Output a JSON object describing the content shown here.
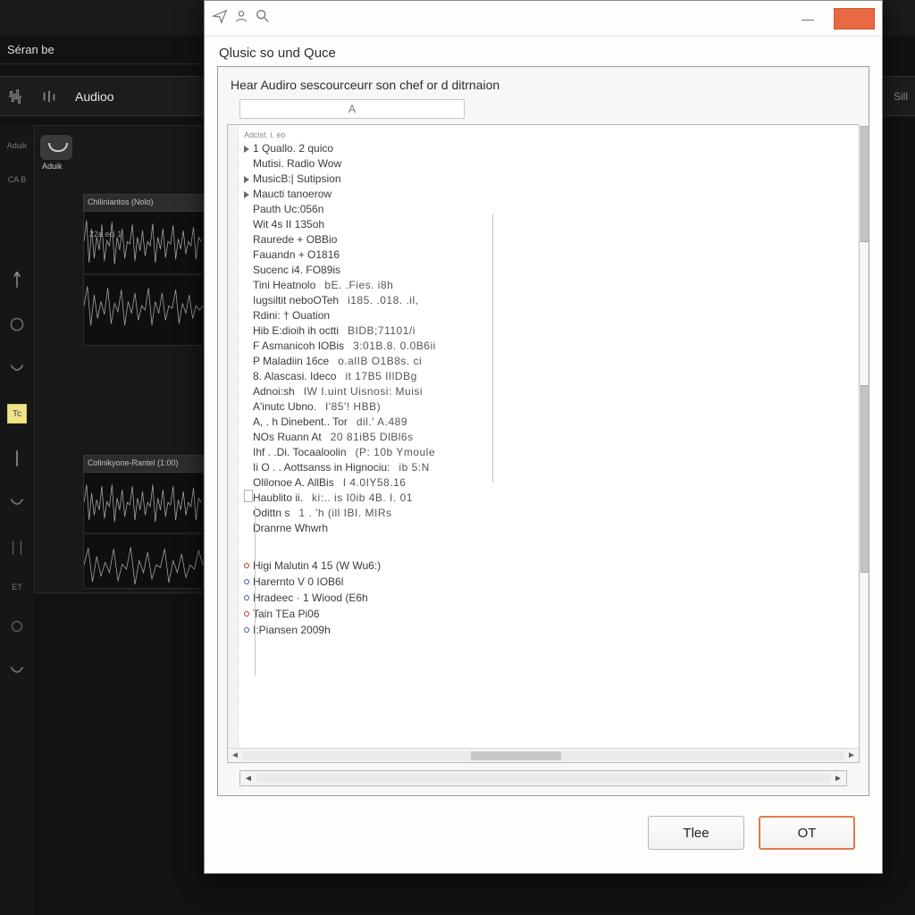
{
  "bg": {
    "subbar_label": "Séran be",
    "toolbar_audio": "Audioo",
    "toolbar_short": "Sill",
    "left_rail_label_top": "Aduik",
    "left_rail_label_ca": "CA B",
    "left_rail_label_et": "ET",
    "tc_label": "Tc",
    "track_mini_label": "Aduik",
    "track1_header": "Chiliniantos (Nolo)",
    "track1_time": "22a eci 1",
    "track2_header": "Colinikyone-Rantel (1:00)"
  },
  "dialog": {
    "title": "Qlusic so und Quce",
    "subheading": "Hear Audiro sescourceurr son chef or d ditrnaion",
    "filter_placeholder": "A",
    "tiny_header": "Adcist.  i.  eo",
    "items": [
      {
        "k": "1  Quallo. 2 quico",
        "m": "arrow"
      },
      {
        "k": "Mutisi. Radio Wow",
        "m": ""
      },
      {
        "k": "MusicB:| Sutipsion",
        "m": "arrow"
      },
      {
        "k": "Maucti  tanoerow",
        "m": "arrow"
      },
      {
        "k": "Pauth  Uc:056n",
        "m": ""
      },
      {
        "k": "Wit 4s II 135oh",
        "m": ""
      },
      {
        "k": "Raurede +  OBBio",
        "m": ""
      },
      {
        "k": "Fauandn +  O1816",
        "m": ""
      },
      {
        "k": "Sucenc i4.  FO89is",
        "m": ""
      },
      {
        "k": "Tini  Heatnolo",
        "v": "bE. .Fies.  i8h",
        "m": ""
      },
      {
        "k": "Iugsiltit  neboOTeh",
        "v": "i185.  .018.  .il,",
        "m": ""
      },
      {
        "k": "Rdini: †  Ouation",
        "m": ""
      },
      {
        "k": "Hib  E:dioih  ih  octti",
        "v": "BIDB;71101/i",
        "m": "",
        "dim": true
      },
      {
        "k": "F Asmanicoh   IOBis",
        "v": "3:01B.8. 0.0B6ii",
        "m": ""
      },
      {
        "k": "P  Maladiin     16ce",
        "v": "o.alIB  O1B8s. ci",
        "m": ""
      },
      {
        "k": "8. Alascasi.     Ideco",
        "v": "it  17B5  IIlDBg",
        "m": ""
      },
      {
        "k": "Adnoi:sh",
        "v": "IW   I.uint   Uisnosi:    Muisi",
        "m": ""
      },
      {
        "k": "A'inutc  Ubno.",
        "v": "I'85'!  HBB)",
        "m": ""
      },
      {
        "k": "A, . h  Dinebent.. Tor",
        "v": "dil.' A.489",
        "m": ""
      },
      {
        "k": "NOs  Ruann  At",
        "v": "20   81iB5   DlBl6s",
        "m": ""
      },
      {
        "k": "Ihf . .Di.  Tocaaloolin",
        "v": "(P:  10b   Ymoule",
        "m": ""
      },
      {
        "k": "Ii O . . Aottsanss in Hignociu:",
        "v": "ib 5:N",
        "m": ""
      },
      {
        "k": "Olilonoe  A.   AllBis",
        "v": "I 4.0IY58.16",
        "m": "",
        "dim": true
      },
      {
        "k": "Haublito  ii.",
        "v": "ki:.. is   I0ib  4B.  I. 01",
        "m": ""
      },
      {
        "k": "Odittn   s",
        "v": "1 . 'h   (ill   IBI.  MIRs",
        "m": ""
      },
      {
        "k": "Dranrne  Whwrh",
        "m": "",
        "dim": true
      }
    ],
    "status_items": [
      {
        "k": "Higi  Malutin  4 15 (W Wu6:)",
        "m": "dot-r"
      },
      {
        "k": "Harernto  V 0  IOB6l",
        "m": "dot-b"
      },
      {
        "k": "Hradeec  · 1  Wiood  (E6h",
        "m": "dot-b"
      },
      {
        "k": "Tain  TEa  Pi06",
        "m": "dot-r"
      },
      {
        "k": "I:Piansen  2009h",
        "m": "dot-b"
      }
    ],
    "btn_secondary": "Tlee",
    "btn_primary": "OT"
  }
}
